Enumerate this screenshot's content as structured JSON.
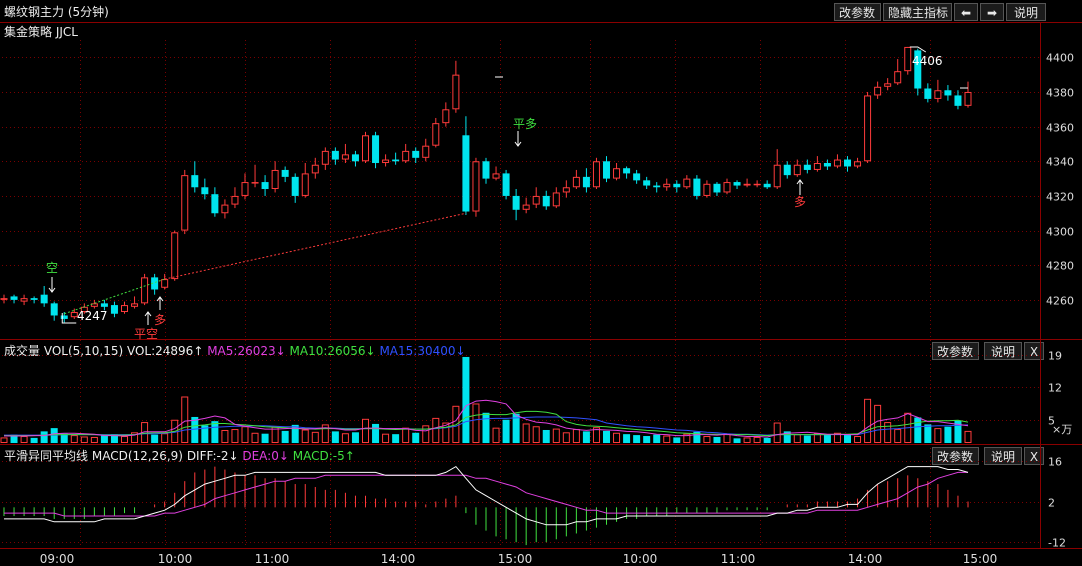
{
  "header": {
    "title": "螺纹钢主力 (5分钟)",
    "subtitle": "集金策略 JJCL",
    "btn_params": "改参数",
    "btn_hide": "隐藏主指标",
    "btn_prev": "⬅",
    "btn_next": "➡",
    "btn_help": "说明"
  },
  "volume_panel": {
    "name": "成交量",
    "indicator": "VOL(5,10,15)",
    "vol": "VOL:24896↑",
    "ma5": "MA5:26023↓",
    "ma10": "MA10:26056↓",
    "ma15": "MA15:30400↓",
    "btn_params": "改参数",
    "btn_help": "说明",
    "btn_close": "X",
    "unit": "×万"
  },
  "macd_panel": {
    "name": "平滑异同平均线",
    "indicator": "MACD(12,26,9)",
    "diff": "DIFF:-2↓",
    "dea": "DEA:0↓",
    "macd": "MACD:-5↑",
    "btn_params": "改参数",
    "btn_help": "说明",
    "btn_close": "X"
  },
  "signals": {
    "short": "空",
    "long1": "多",
    "close_short": "平空",
    "close_long": "平多",
    "long2": "多",
    "low_label": "4247",
    "high_label": "4406"
  },
  "colors": {
    "up": "#ff3b3b",
    "down": "#00e5ee",
    "ma5": "#e040e0",
    "ma10": "#40e040",
    "ma15": "#3050ff",
    "diff": "#ffffff",
    "dea": "#e040e0",
    "grid": "#7a0000"
  },
  "chart_data": {
    "type": "candlestick",
    "price_axis": {
      "ticks": [
        4260,
        4280,
        4300,
        4320,
        4340,
        4360,
        4380,
        4400
      ],
      "range": [
        4238,
        4410
      ]
    },
    "volume_axis": {
      "ticks": [
        5,
        12,
        19
      ],
      "range": [
        0,
        20
      ]
    },
    "macd_axis": {
      "ticks": [
        -12,
        2,
        16
      ],
      "range": [
        -14,
        18
      ]
    },
    "time_labels": [
      "09:00",
      "10:00",
      "11:00",
      "14:00",
      "15:00",
      "10:00",
      "11:00",
      "14:00",
      "15:00"
    ],
    "candles": [
      [
        4260,
        4261,
        4263,
        4258
      ],
      [
        4262,
        4260,
        4263,
        4258
      ],
      [
        4259,
        4261,
        4263,
        4257
      ],
      [
        4261,
        4260,
        4262,
        4258
      ],
      [
        4263,
        4258,
        4268,
        4256
      ],
      [
        4258,
        4251,
        4259,
        4248
      ],
      [
        4251,
        4249,
        4253,
        4247
      ],
      [
        4250,
        4253,
        4255,
        4249
      ],
      [
        4253,
        4256,
        4258,
        4252
      ],
      [
        4256,
        4258,
        4260,
        4255
      ],
      [
        4258,
        4256,
        4260,
        4254
      ],
      [
        4257,
        4252,
        4259,
        4250
      ],
      [
        4253,
        4257,
        4259,
        4252
      ],
      [
        4256,
        4258,
        4262,
        4255
      ],
      [
        4258,
        4273,
        4275,
        4257
      ],
      [
        4273,
        4266,
        4275,
        4263
      ],
      [
        4267,
        4272,
        4275,
        4266
      ],
      [
        4272,
        4299,
        4300,
        4271
      ],
      [
        4300,
        4332,
        4335,
        4298
      ],
      [
        4332,
        4325,
        4340,
        4322
      ],
      [
        4325,
        4321,
        4330,
        4318
      ],
      [
        4321,
        4310,
        4325,
        4308
      ],
      [
        4310,
        4315,
        4318,
        4307
      ],
      [
        4315,
        4320,
        4325,
        4313
      ],
      [
        4320,
        4328,
        4333,
        4318
      ],
      [
        4328,
        4328,
        4338,
        4325
      ],
      [
        4328,
        4324,
        4332,
        4320
      ],
      [
        4324,
        4335,
        4340,
        4322
      ],
      [
        4335,
        4331,
        4337,
        4328
      ],
      [
        4331,
        4320,
        4333,
        4316
      ],
      [
        4320,
        4333,
        4339,
        4319
      ],
      [
        4333,
        4338,
        4342,
        4330
      ],
      [
        4338,
        4346,
        4348,
        4335
      ],
      [
        4346,
        4341,
        4348,
        4338
      ],
      [
        4341,
        4344,
        4350,
        4339
      ],
      [
        4344,
        4340,
        4346,
        4337
      ],
      [
        4340,
        4355,
        4357,
        4339
      ],
      [
        4355,
        4339,
        4357,
        4336
      ],
      [
        4339,
        4341,
        4344,
        4337
      ],
      [
        4341,
        4340,
        4345,
        4338
      ],
      [
        4340,
        4346,
        4350,
        4339
      ],
      [
        4346,
        4342,
        4348,
        4339
      ],
      [
        4342,
        4349,
        4353,
        4340
      ],
      [
        4349,
        4362,
        4365,
        4348
      ],
      [
        4362,
        4370,
        4374,
        4360
      ],
      [
        4370,
        4390,
        4398,
        4368
      ],
      [
        4355,
        4311,
        4366,
        4309
      ],
      [
        4311,
        4340,
        4342,
        4308
      ],
      [
        4340,
        4330,
        4342,
        4327
      ],
      [
        4330,
        4333,
        4337,
        4329
      ],
      [
        4333,
        4320,
        4335,
        4318
      ],
      [
        4320,
        4312,
        4324,
        4306
      ],
      [
        4312,
        4315,
        4319,
        4310
      ],
      [
        4315,
        4320,
        4325,
        4313
      ],
      [
        4320,
        4314,
        4323,
        4312
      ],
      [
        4314,
        4322,
        4325,
        4313
      ],
      [
        4322,
        4325,
        4329,
        4319
      ],
      [
        4325,
        4331,
        4335,
        4324
      ],
      [
        4331,
        4325,
        4336,
        4322
      ],
      [
        4325,
        4340,
        4342,
        4324
      ],
      [
        4340,
        4330,
        4343,
        4328
      ],
      [
        4330,
        4336,
        4339,
        4329
      ],
      [
        4336,
        4333,
        4337,
        4330
      ],
      [
        4333,
        4329,
        4335,
        4327
      ],
      [
        4329,
        4326,
        4331,
        4324
      ],
      [
        4326,
        4325,
        4328,
        4322
      ],
      [
        4325,
        4327,
        4330,
        4323
      ],
      [
        4327,
        4325,
        4329,
        4322
      ],
      [
        4325,
        4330,
        4332,
        4324
      ],
      [
        4330,
        4320,
        4332,
        4318
      ],
      [
        4320,
        4327,
        4329,
        4319
      ],
      [
        4327,
        4322,
        4328,
        4320
      ],
      [
        4322,
        4328,
        4330,
        4321
      ],
      [
        4328,
        4326,
        4329,
        4324
      ],
      [
        4326,
        4327,
        4330,
        4325
      ],
      [
        4327,
        4327,
        4329,
        4325
      ],
      [
        4327,
        4325,
        4329,
        4324
      ],
      [
        4325,
        4338,
        4347,
        4324
      ],
      [
        4338,
        4332,
        4340,
        4330
      ],
      [
        4332,
        4338,
        4341,
        4331
      ],
      [
        4338,
        4335,
        4341,
        4333
      ],
      [
        4335,
        4339,
        4343,
        4334
      ],
      [
        4339,
        4337,
        4341,
        4335
      ],
      [
        4337,
        4341,
        4344,
        4336
      ],
      [
        4341,
        4337,
        4343,
        4334
      ],
      [
        4337,
        4340,
        4342,
        4336
      ],
      [
        4340,
        4378,
        4380,
        4339
      ],
      [
        4378,
        4383,
        4386,
        4376
      ],
      [
        4383,
        4385,
        4388,
        4381
      ],
      [
        4385,
        4392,
        4399,
        4384
      ],
      [
        4392,
        4406,
        4406,
        4390
      ],
      [
        4404,
        4382,
        4405,
        4378
      ],
      [
        4382,
        4376,
        4385,
        4374
      ],
      [
        4376,
        4381,
        4387,
        4374
      ],
      [
        4381,
        4378,
        4384,
        4375
      ],
      [
        4378,
        4372,
        4381,
        4370
      ],
      [
        4372,
        4380,
        4386,
        4371
      ]
    ],
    "volume": [
      1.2,
      1.8,
      1.5,
      1.1,
      2.5,
      3.2,
      2.0,
      1.7,
      1.4,
      1.3,
      1.6,
      1.9,
      1.5,
      2.3,
      4.5,
      1.8,
      2.1,
      5.0,
      10.0,
      5.6,
      3.8,
      4.7,
      2.8,
      3.0,
      3.6,
      2.2,
      2.0,
      3.5,
      2.6,
      3.9,
      2.9,
      2.4,
      4.0,
      2.5,
      2.1,
      2.3,
      5.2,
      4.1,
      2.0,
      1.9,
      3.3,
      2.2,
      3.8,
      5.4,
      4.4,
      8.0,
      18.5,
      8.5,
      6.5,
      3.3,
      5.0,
      6.3,
      4.2,
      3.6,
      2.8,
      3.1,
      2.3,
      3.0,
      2.5,
      3.4,
      2.6,
      2.2,
      1.9,
      1.7,
      1.5,
      1.8,
      1.6,
      1.2,
      2.0,
      2.4,
      1.5,
      1.3,
      2.0,
      1.0,
      1.2,
      1.3,
      1.1,
      4.4,
      2.5,
      1.9,
      1.6,
      2.1,
      1.8,
      2.2,
      1.9,
      1.5,
      9.5,
      8.2,
      4.5,
      3.0,
      6.5,
      5.5,
      4.0,
      3.2,
      3.5,
      4.8,
      2.6
    ],
    "ma5": [
      1.5,
      1.5,
      1.5,
      1.6,
      1.6,
      2.0,
      2.1,
      2.1,
      2.0,
      1.9,
      1.6,
      1.6,
      1.5,
      1.7,
      2.4,
      2.4,
      2.4,
      3.1,
      4.7,
      4.9,
      5.3,
      5.8,
      5.4,
      4.0,
      3.6,
      3.3,
      3.0,
      3.0,
      3.1,
      3.2,
      3.0,
      3.1,
      3.3,
      3.1,
      2.8,
      2.8,
      3.2,
      3.2,
      3.1,
      3.1,
      3.1,
      2.7,
      2.6,
      3.3,
      3.8,
      4.8,
      8.0,
      9.0,
      9.2,
      8.9,
      8.4,
      6.0,
      5.1,
      4.5,
      4.3,
      3.9,
      3.2,
      2.9,
      2.7,
      2.9,
      2.8,
      2.7,
      2.5,
      2.4,
      2.2,
      1.9,
      1.8,
      1.6,
      1.6,
      1.8,
      1.8,
      1.7,
      1.9,
      1.6,
      1.4,
      1.4,
      1.3,
      1.8,
      2.1,
      2.2,
      2.3,
      2.1,
      1.9,
      1.9,
      1.8,
      1.8,
      3.4,
      4.7,
      5.1,
      5.4,
      6.3,
      5.5,
      4.6,
      4.6,
      4.3,
      4.0,
      3.7
    ],
    "ma10": [
      1.6,
      1.6,
      1.6,
      1.6,
      1.7,
      1.8,
      1.8,
      1.8,
      1.8,
      1.8,
      1.7,
      1.7,
      1.7,
      1.8,
      2.1,
      2.2,
      2.2,
      2.5,
      3.4,
      3.7,
      3.9,
      4.2,
      4.2,
      4.0,
      3.9,
      3.7,
      3.5,
      3.4,
      3.3,
      3.1,
      3.1,
      3.0,
      3.1,
      3.1,
      3.0,
      3.0,
      3.1,
      3.1,
      3.0,
      2.9,
      3.0,
      3.0,
      3.0,
      3.2,
      3.4,
      3.9,
      5.5,
      6.0,
      6.2,
      6.1,
      6.1,
      6.5,
      6.8,
      6.8,
      6.6,
      6.2,
      4.6,
      4.0,
      3.7,
      3.6,
      3.5,
      3.3,
      3.1,
      2.9,
      2.7,
      2.6,
      2.4,
      2.2,
      2.1,
      2.0,
      1.9,
      1.9,
      1.8,
      1.8,
      1.8,
      1.7,
      1.6,
      1.8,
      1.8,
      1.8,
      1.8,
      1.8,
      1.8,
      1.9,
      1.9,
      2.0,
      2.8,
      3.5,
      3.6,
      3.7,
      4.0,
      4.4,
      4.7,
      4.8,
      4.8,
      4.9,
      4.5
    ],
    "ma15": [
      1.7,
      1.7,
      1.7,
      1.7,
      1.7,
      1.7,
      1.8,
      1.8,
      1.8,
      1.8,
      1.8,
      1.8,
      1.8,
      1.8,
      2.0,
      2.0,
      2.1,
      2.3,
      2.8,
      3.0,
      3.2,
      3.4,
      3.5,
      3.6,
      3.6,
      3.7,
      3.7,
      3.6,
      3.5,
      3.5,
      3.3,
      3.2,
      3.2,
      3.2,
      3.1,
      3.1,
      3.1,
      3.1,
      3.1,
      3.1,
      3.1,
      3.0,
      3.0,
      3.1,
      3.3,
      3.6,
      4.6,
      5.0,
      5.2,
      5.3,
      5.3,
      5.4,
      5.5,
      5.6,
      5.6,
      5.6,
      5.5,
      5.4,
      5.2,
      5.0,
      4.3,
      4.0,
      3.7,
      3.5,
      3.4,
      3.2,
      3.0,
      2.8,
      2.7,
      2.5,
      2.3,
      2.2,
      2.0,
      1.9,
      1.9,
      1.8,
      1.7,
      1.8,
      1.8,
      1.8,
      1.8,
      1.8,
      1.8,
      1.8,
      1.8,
      1.8,
      2.3,
      2.8,
      3.0,
      3.1,
      3.3,
      3.5,
      3.6,
      3.7,
      3.7,
      3.8,
      3.9
    ],
    "macd_hist": [
      -3,
      -3,
      -3,
      -3,
      -3,
      -4,
      -4,
      -4,
      -4,
      -3,
      -3,
      -3,
      -2,
      -2,
      0,
      1,
      2,
      5,
      9,
      12,
      13,
      14,
      13,
      12,
      11,
      11,
      10,
      10,
      9,
      8,
      8,
      7,
      6,
      6,
      5,
      4,
      4,
      3,
      3,
      2,
      2,
      2,
      1,
      2,
      3,
      4,
      -2,
      -6,
      -8,
      -10,
      -11,
      -12,
      -13,
      -12,
      -12,
      -11,
      -10,
      -9,
      -8,
      -7,
      -6,
      -5,
      -4,
      -4,
      -3,
      -3,
      -3,
      -2,
      -2,
      -2,
      -2,
      -2,
      -1,
      -1,
      -1,
      -1,
      -1,
      0,
      1,
      1,
      1,
      2,
      2,
      2,
      2,
      3,
      6,
      8,
      9,
      10,
      11,
      10,
      9,
      8,
      6,
      4,
      2
    ],
    "diff": [
      -4,
      -4,
      -4,
      -4,
      -4,
      -5,
      -5,
      -5,
      -5,
      -5,
      -4,
      -4,
      -4,
      -4,
      -3,
      -2,
      -1,
      1,
      4,
      6,
      8,
      9,
      10,
      11,
      11,
      12,
      12,
      12,
      12,
      12,
      12,
      12,
      12,
      12,
      12,
      12,
      12,
      12,
      11,
      11,
      11,
      11,
      11,
      11,
      12,
      14,
      10,
      6,
      4,
      2,
      0,
      -2,
      -4,
      -5,
      -6,
      -6,
      -6,
      -5,
      -5,
      -4,
      -4,
      -4,
      -3,
      -3,
      -3,
      -3,
      -3,
      -3,
      -3,
      -3,
      -3,
      -3,
      -3,
      -3,
      -3,
      -3,
      -3,
      -2,
      -2,
      -1,
      -1,
      0,
      0,
      0,
      1,
      1,
      5,
      8,
      10,
      12,
      14,
      14,
      14,
      14,
      13,
      13,
      12
    ],
    "dea": [
      -2,
      -2,
      -2,
      -2,
      -2,
      -2,
      -3,
      -3,
      -3,
      -3,
      -3,
      -3,
      -3,
      -3,
      -3,
      -3,
      -2,
      -2,
      -1,
      0,
      1,
      3,
      4,
      5,
      6,
      7,
      8,
      9,
      9,
      10,
      10,
      10,
      11,
      11,
      11,
      11,
      11,
      11,
      11,
      11,
      11,
      11,
      11,
      11,
      11,
      11,
      11,
      10,
      10,
      9,
      8,
      7,
      5,
      4,
      3,
      2,
      1,
      0,
      -1,
      -1,
      -2,
      -2,
      -2,
      -2,
      -2,
      -2,
      -2,
      -2,
      -2,
      -2,
      -2,
      -2,
      -2,
      -2,
      -2,
      -2,
      -2,
      -2,
      -2,
      -2,
      -2,
      -1,
      -1,
      -1,
      -1,
      -1,
      0,
      1,
      2,
      3,
      5,
      7,
      8,
      10,
      11,
      12,
      12
    ]
  }
}
